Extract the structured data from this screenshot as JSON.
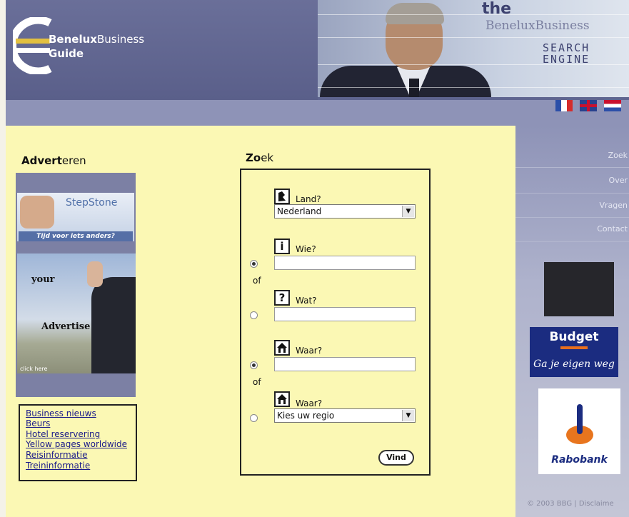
{
  "header": {
    "logo_brand_bold": "Benelux",
    "logo_brand_rest": "Business",
    "logo_guide": "Guide",
    "banner_the": "the",
    "banner_name": "BeneluxBusiness",
    "banner_line1": "SEARCH",
    "banner_line2": "ENGINE"
  },
  "languages": [
    {
      "name": "fr-flag-icon",
      "color": "#2b4fa8"
    },
    {
      "name": "uk-flag-icon",
      "color": "#28418d"
    },
    {
      "name": "nl-flag-icon",
      "color": "#c8102e"
    }
  ],
  "left": {
    "heading_bold": "Advert",
    "heading_rest": "eren",
    "stepstone_name": "StepStone",
    "stepstone_tagline": "Tijd voor iets anders?",
    "banner_your": "your",
    "banner_advertise": "Advertise",
    "banner_click": "click here",
    "links": [
      "Business nieuws",
      "Beurs",
      "Hotel reservering",
      "Yellow pages worldwide",
      "Reisinformatie",
      "Treininformatie"
    ]
  },
  "search": {
    "heading_bold": "Zo",
    "heading_rest": "ek",
    "land_label": "Land?",
    "land_value": "Nederland",
    "wie_label": "Wie?",
    "of_label": "of",
    "wat_label": "Wat?",
    "waar_label": "Waar?",
    "waar2_label": "Waar?",
    "regio_value": "Kies uw regio",
    "submit_label": "Vind"
  },
  "right": {
    "menu": [
      "Zoek",
      "Over",
      "Vragen",
      "Contact"
    ],
    "budget_name": "Budget",
    "budget_slogan": "Ga je eigen weg",
    "rabobank_name": "Rabobank",
    "copyright": "© 2003 BBG | Disclaime"
  },
  "colors": {
    "header_bg": "#5f6590",
    "main_bg": "#fbf8b4",
    "link_color": "#1a1a8a",
    "budget_blue": "#1b2c80",
    "rabobank_orange": "#e8751e"
  }
}
